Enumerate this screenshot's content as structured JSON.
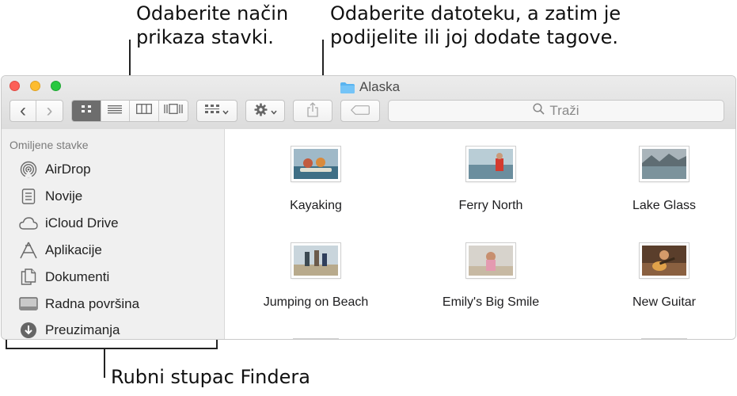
{
  "callouts": {
    "view_mode": [
      "Odaberite način",
      "prikaza stavki."
    ],
    "share": [
      "Odaberite datoteku, a zatim je",
      "podijelite ili joj dodate tagove."
    ],
    "sidebar": "Rubni stupac Findera"
  },
  "window": {
    "title": "Alaska"
  },
  "toolbar": {
    "back": "‹",
    "forward": "›",
    "search_placeholder": "Traži"
  },
  "sidebar": {
    "header": "Omiljene stavke",
    "items": [
      {
        "label": "AirDrop",
        "icon": "airdrop-icon"
      },
      {
        "label": "Novije",
        "icon": "recents-icon"
      },
      {
        "label": "iCloud Drive",
        "icon": "cloud-icon"
      },
      {
        "label": "Aplikacije",
        "icon": "applications-icon"
      },
      {
        "label": "Dokumenti",
        "icon": "documents-icon"
      },
      {
        "label": "Radna površina",
        "icon": "desktop-icon"
      },
      {
        "label": "Preuzimanja",
        "icon": "downloads-icon"
      }
    ]
  },
  "files": [
    {
      "name": "Kayaking"
    },
    {
      "name": "Ferry North"
    },
    {
      "name": "Lake Glass"
    },
    {
      "name": "Jumping on Beach"
    },
    {
      "name": "Emily's Big Smile"
    },
    {
      "name": "New Guitar"
    }
  ]
}
